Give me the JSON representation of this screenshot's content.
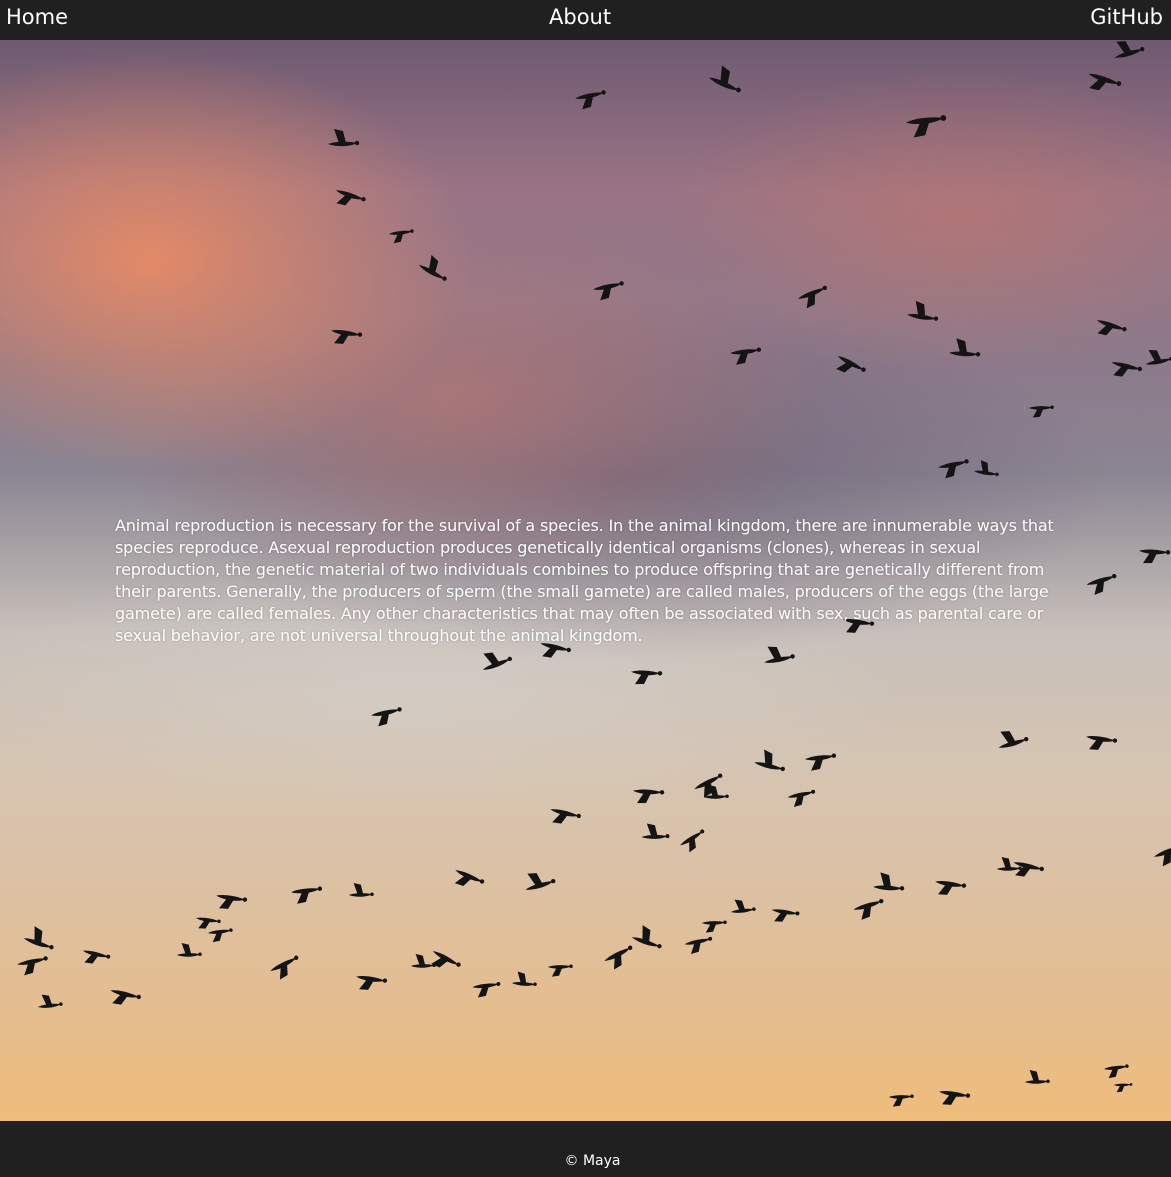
{
  "nav": {
    "home": "Home",
    "about": "About",
    "github": "GitHub"
  },
  "hero": {
    "image_description_icon": "flock-of-geese-at-sunset-image",
    "intro": "Animal reproduction is necessary for the survival of a species. In the animal kingdom, there are innumerable ways that species reproduce. Asexual reproduction produces genetically identical organisms (clones), whereas in sexual reproduction, the genetic material of two individuals combines to produce offspring that are genetically different from their parents. Generally, the producers of sperm (the small gamete) are called males, producers of the eggs (the large gamete) are called females. Any other characteristics that may often be associated with sex, such as parental care or sexual behavior, are not universal throughout the animal kingdom."
  },
  "footer": {
    "copyright": "© Maya"
  },
  "colors": {
    "bar_background": "#202020",
    "text": "#ffffff",
    "bird": "#141414"
  }
}
